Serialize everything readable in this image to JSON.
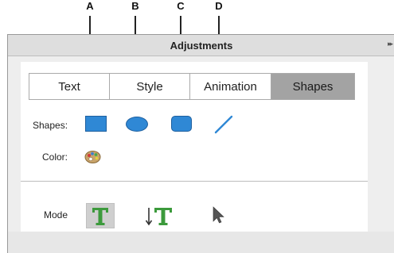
{
  "callouts": [
    "A",
    "B",
    "C",
    "D"
  ],
  "panel": {
    "title": "Adjustments",
    "expand_glyph": "▸▸"
  },
  "tabs": [
    {
      "label": "Text",
      "active": false
    },
    {
      "label": "Style",
      "active": false
    },
    {
      "label": "Animation",
      "active": false
    },
    {
      "label": "Shapes",
      "active": true
    }
  ],
  "shapes": {
    "label": "Shapes:",
    "items": [
      "rectangle-icon",
      "ellipse-icon",
      "rounded-rectangle-icon",
      "line-icon"
    ]
  },
  "color": {
    "label": "Color:",
    "icon": "color-palette-icon"
  },
  "mode": {
    "label": "Mode",
    "items": [
      "text-tool-icon",
      "text-on-path-tool-icon",
      "selection-arrow-icon"
    ]
  },
  "colors": {
    "shape_fill": "#2f88d5",
    "active_tab": "#a3a3a3",
    "text_tool_green": "#3c9a3c"
  }
}
